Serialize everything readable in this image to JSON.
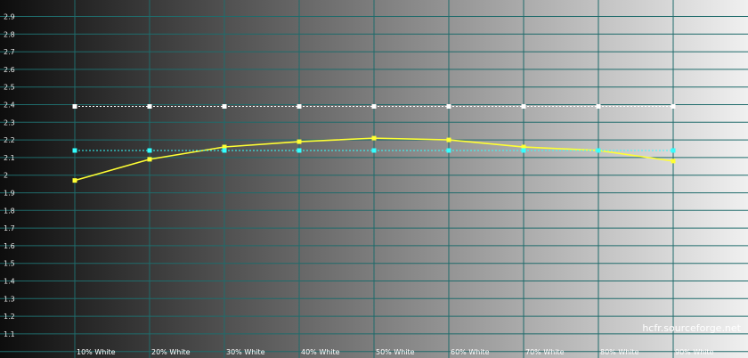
{
  "chart_data": {
    "type": "line",
    "categories": [
      "10% White",
      "20% White",
      "30% White",
      "40% White",
      "50% White",
      "60% White",
      "70% White",
      "80% White",
      "90% White"
    ],
    "y_ticks": [
      "2.9",
      "2.8",
      "2.7",
      "2.6",
      "2.5",
      "2.4",
      "2.3",
      "2.2",
      "2.1",
      "2",
      "1.9",
      "1.8",
      "1.7",
      "1.6",
      "1.5",
      "1.4",
      "1.3",
      "1.2",
      "1.1"
    ],
    "ylim": [
      1.05,
      2.98
    ],
    "grid": true,
    "series": [
      {
        "values": [
          1.97,
          2.09,
          2.16,
          2.19,
          2.21,
          2.2,
          2.16,
          2.14,
          2.08
        ],
        "color": "#ffff33"
      },
      {
        "values": [
          2.14,
          2.14,
          2.14,
          2.14,
          2.14,
          2.14,
          2.14,
          2.14,
          2.14
        ],
        "color": "#33ffff"
      },
      {
        "values": [
          2.39,
          2.39,
          2.39,
          2.39,
          2.39,
          2.39,
          2.39,
          2.39,
          2.39
        ],
        "color": "#ffffff"
      }
    ],
    "background": "grayscale gradient, dark left to light right",
    "grid_color": "#1f6b6b"
  },
  "watermark": "hcfr.sourceforge.net"
}
